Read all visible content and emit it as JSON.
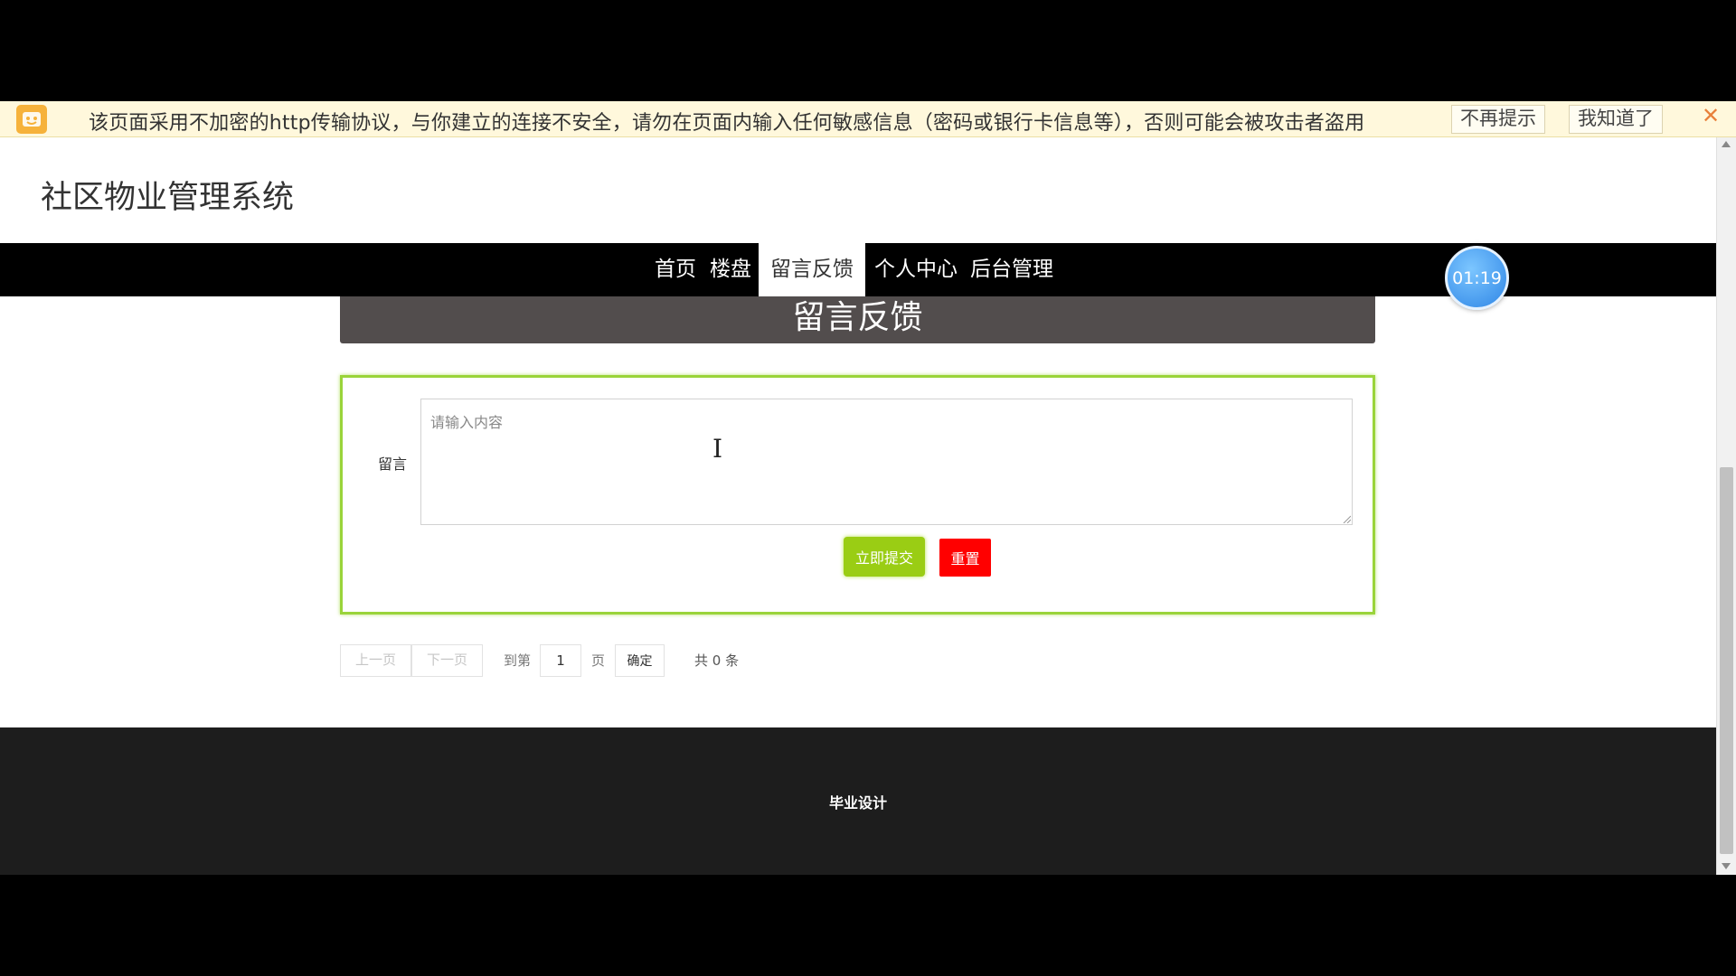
{
  "warning_bar": {
    "message": "该页面采用不加密的http传输协议，与你建立的连接不安全，请勿在页面内输入任何敏感信息（密码或银行卡信息等），否则可能会被攻击者盗用",
    "dont_remind_label": "不再提示",
    "got_it_label": "我知道了",
    "close_icon": "✕"
  },
  "site": {
    "title": "社区物业管理系统"
  },
  "nav": {
    "items": [
      {
        "label": "首页"
      },
      {
        "label": "楼盘"
      },
      {
        "label": "留言反馈",
        "active": true
      },
      {
        "label": "个人中心"
      },
      {
        "label": "后台管理"
      }
    ],
    "timer": "01:19"
  },
  "section": {
    "heading": "留言反馈"
  },
  "form": {
    "label": "留言",
    "placeholder": "请输入内容",
    "submit_label": "立即提交",
    "reset_label": "重置"
  },
  "pager": {
    "prev_label": "上一页",
    "next_label": "下一页",
    "goto_label": "到第",
    "page_value": "1",
    "page_unit": "页",
    "confirm_label": "确定",
    "total": "共 0 条"
  },
  "footer": {
    "text": "毕业设计"
  },
  "colors": {
    "accent_green": "#9acd14",
    "reset_red": "#ff0000",
    "banner_gray": "#524d4d",
    "warning_bg": "#fff8dc"
  }
}
